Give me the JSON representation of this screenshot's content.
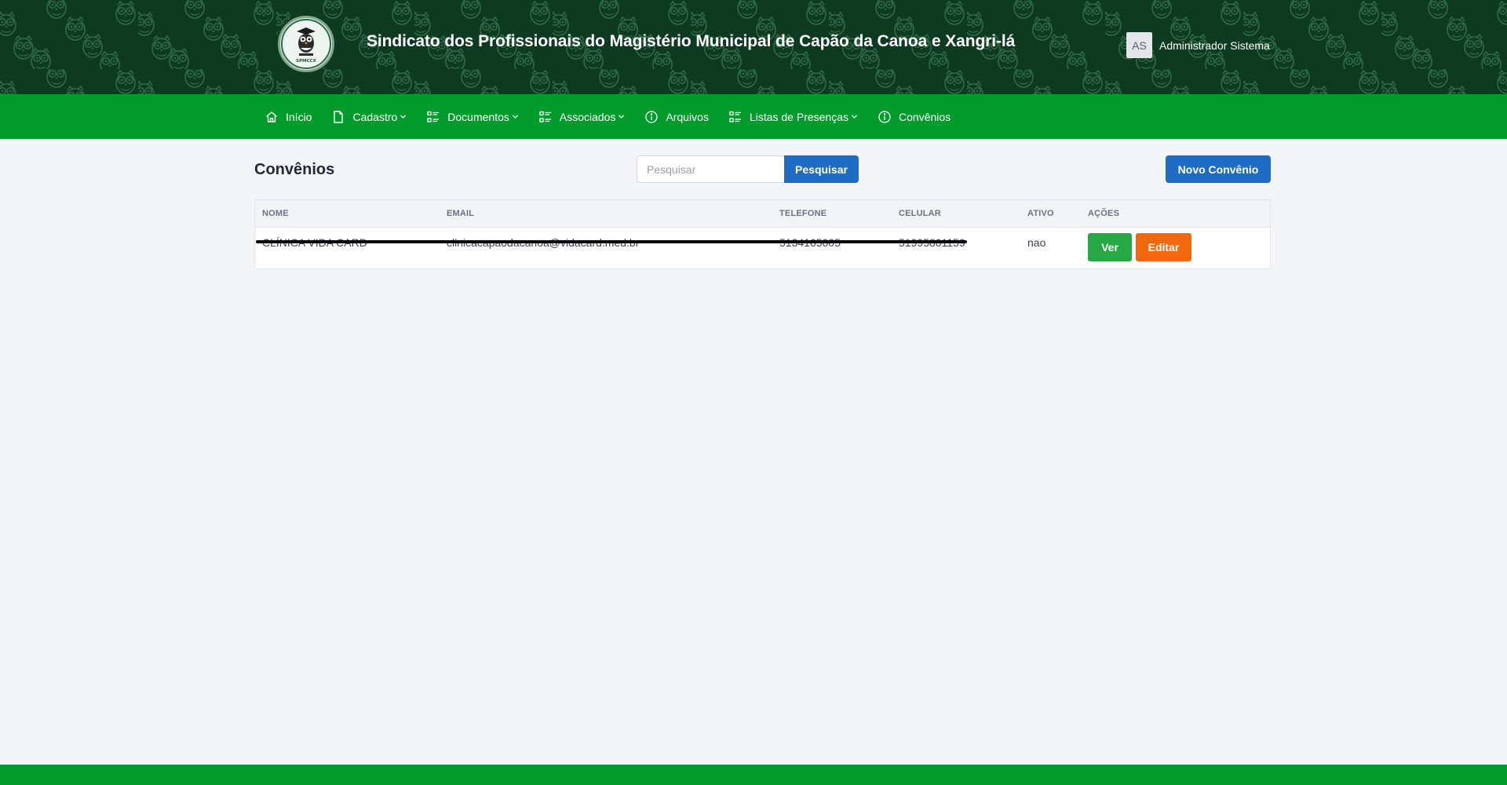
{
  "colors": {
    "header_bg": "#0e3a21",
    "nav_bg": "#029b2c",
    "primary": "#1f6cc4",
    "ver_button": "#28a745",
    "editar_button": "#f0690f"
  },
  "header": {
    "logo_text": "SPMCCX",
    "title": "Sindicato dos Profissionais do Magistério Municipal de Capão da Canoa e Xangri-lá",
    "user": {
      "initials": "AS",
      "name": "Administrador Sistema"
    }
  },
  "nav": {
    "items": [
      {
        "label": "Início",
        "icon": "home-icon",
        "has_dropdown": false
      },
      {
        "label": "Cadastro",
        "icon": "document-icon",
        "has_dropdown": true
      },
      {
        "label": "Documentos",
        "icon": "list-icon",
        "has_dropdown": true
      },
      {
        "label": "Associados",
        "icon": "list-icon",
        "has_dropdown": true
      },
      {
        "label": "Arquivos",
        "icon": "info-icon",
        "has_dropdown": false
      },
      {
        "label": "Listas de Presenças",
        "icon": "list-icon",
        "has_dropdown": true
      },
      {
        "label": "Convênios",
        "icon": "info-icon",
        "has_dropdown": false
      }
    ]
  },
  "page": {
    "title": "Convênios",
    "search": {
      "placeholder": "Pesquisar",
      "value": "",
      "button_label": "Pesquisar"
    },
    "new_button_label": "Novo Convênio"
  },
  "table": {
    "columns": [
      "NOME",
      "EMAIL",
      "TELEFONE",
      "CELULAR",
      "ATIVO",
      "AÇÕES"
    ],
    "rows": [
      {
        "nome": "CLÍNICA VIDA CARD",
        "email": "clinicacapaodacanoa@vidacard.med.br",
        "telefone": "5134165005",
        "celular": "51995801159",
        "ativo": "nao",
        "actions": {
          "ver": "Ver",
          "editar": "Editar"
        }
      }
    ]
  }
}
